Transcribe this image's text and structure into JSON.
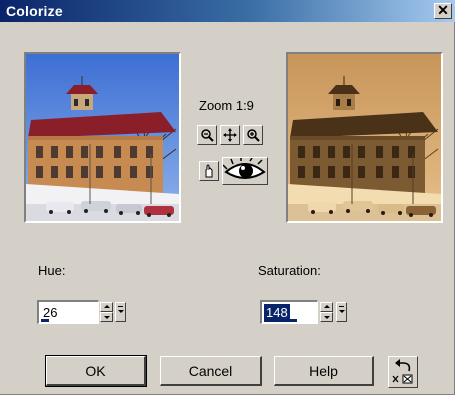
{
  "window": {
    "title": "Colorize",
    "close_glyph": "✕"
  },
  "preview": {
    "zoom_label": "Zoom 1:9"
  },
  "toolbar": {
    "icons": [
      "zoom-out-icon",
      "pan-icon",
      "zoom-in-icon",
      "hand-icon",
      "eye-icon"
    ]
  },
  "hue": {
    "label": "Hue:",
    "value": "26"
  },
  "saturation": {
    "label": "Saturation:",
    "value": "148"
  },
  "buttons": {
    "ok": "OK",
    "cancel": "Cancel",
    "help": "Help"
  },
  "colors": {
    "title_start": "#0a246a",
    "title_end": "#a6caf0",
    "selection": "#0a246a",
    "sepia": "#c89a5a"
  }
}
